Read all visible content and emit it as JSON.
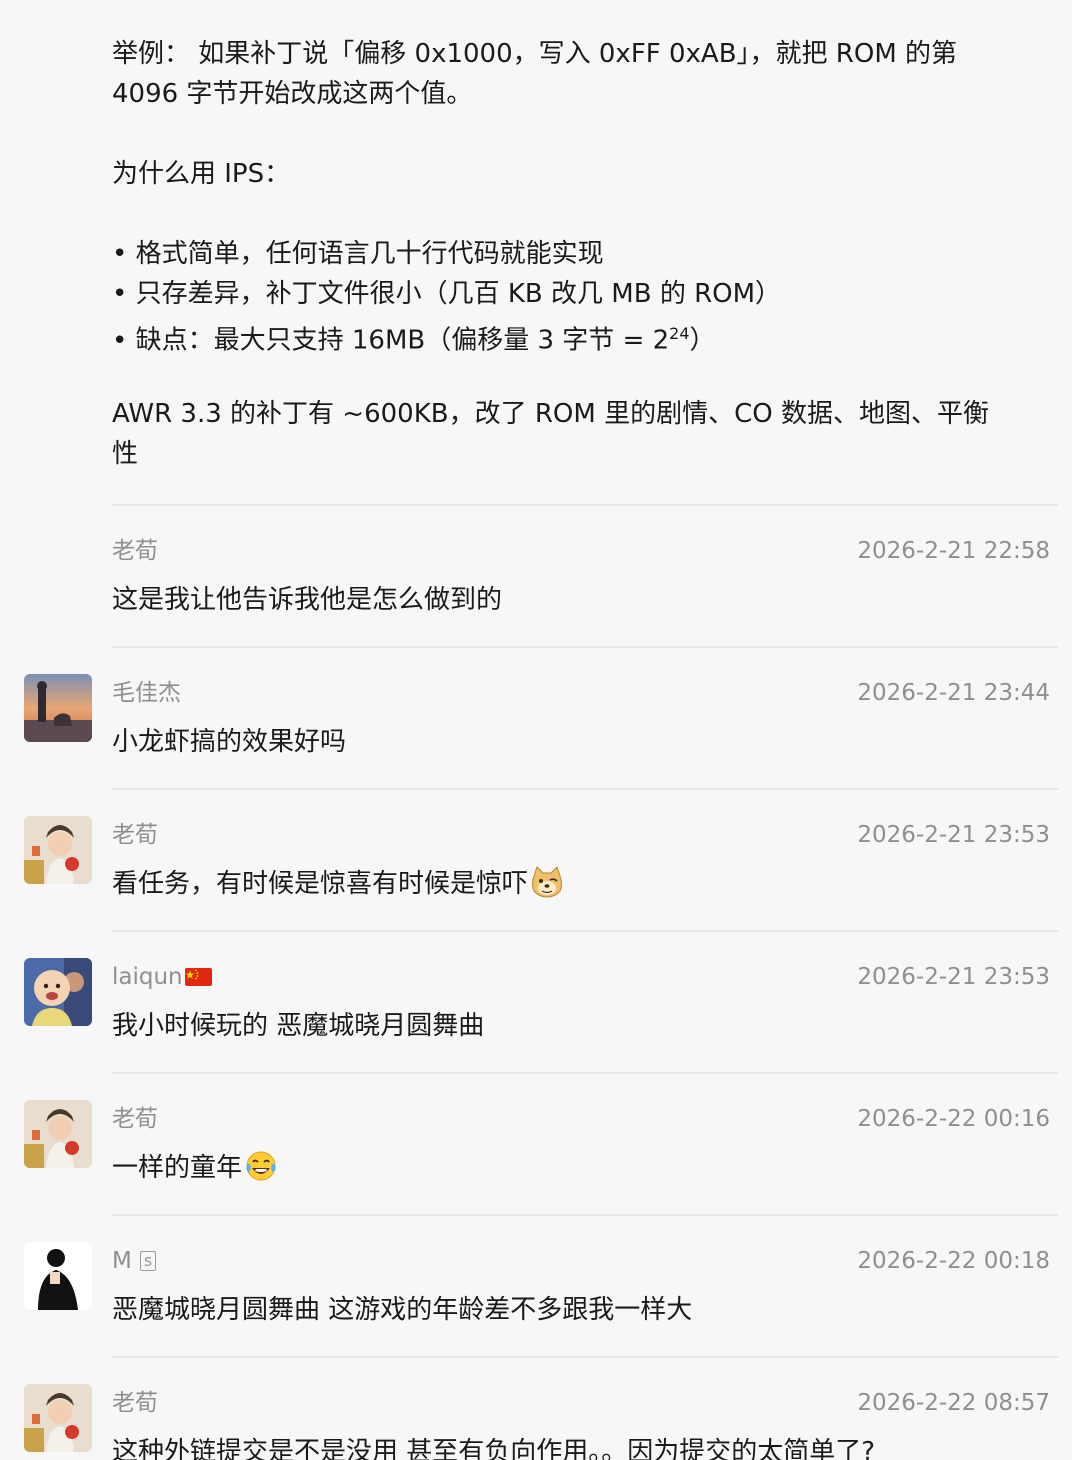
{
  "intro": {
    "example_line1": "举例： 如果补丁说「偏移 0x1000，写入 0xFF 0xAB」，就把 ROM 的第",
    "example_line2": "4096 字节开始改成这两个值。",
    "why_ips": "为什么用 IPS：",
    "bullet1": "格式简单，任何语言几十行代码就能实现",
    "bullet2": "只存差异，补丁文件很小（几百 KB 改几 MB 的 ROM）",
    "bullet3_pre": "缺点：最大只支持 16MB（偏移量 3 字节 = 2",
    "bullet3_sup": "24",
    "bullet3_post": "）",
    "awr_line1": "AWR 3.3 的补丁有 ~600KB，改了 ROM 里的剧情、CO 数据、地图、平衡",
    "awr_line2": "性"
  },
  "messages": [
    {
      "user": "老荀",
      "time": "2026-2-21 22:58",
      "text": "这是我让他告诉我他是怎么做到的",
      "avatar": "none"
    },
    {
      "user": "毛佳杰",
      "time": "2026-2-21 23:44",
      "text": "小龙虾搞的效果好吗",
      "avatar": "sunset-dog-avatar"
    },
    {
      "user": "老荀",
      "time": "2026-2-21 23:53",
      "text": "看任务，有时候是惊喜有时候是惊吓",
      "avatar": "girl-avatar",
      "emoji": "doge-emoji"
    },
    {
      "user": "laiqun",
      "time": "2026-2-21 23:53",
      "text": "我小时候玩的 恶魔城晓月圆舞曲",
      "avatar": "baby-avatar",
      "flag": "china-flag-icon"
    },
    {
      "user": "老荀",
      "time": "2026-2-22 00:16",
      "text": "一样的童年",
      "avatar": "girl-avatar",
      "emoji": "tears-of-joy-emoji"
    },
    {
      "user": "M",
      "badge": "s",
      "time": "2026-2-22 00:18",
      "text": "恶魔城晓月圆舞曲 这游戏的年龄差不多跟我一样大",
      "avatar": "silhouette-avatar"
    },
    {
      "user": "老荀",
      "time": "2026-2-22 08:57",
      "text": "这种外链提交是不是没用 甚至有负向作用。。因为提交的太简单了?",
      "avatar": "girl-avatar"
    }
  ]
}
